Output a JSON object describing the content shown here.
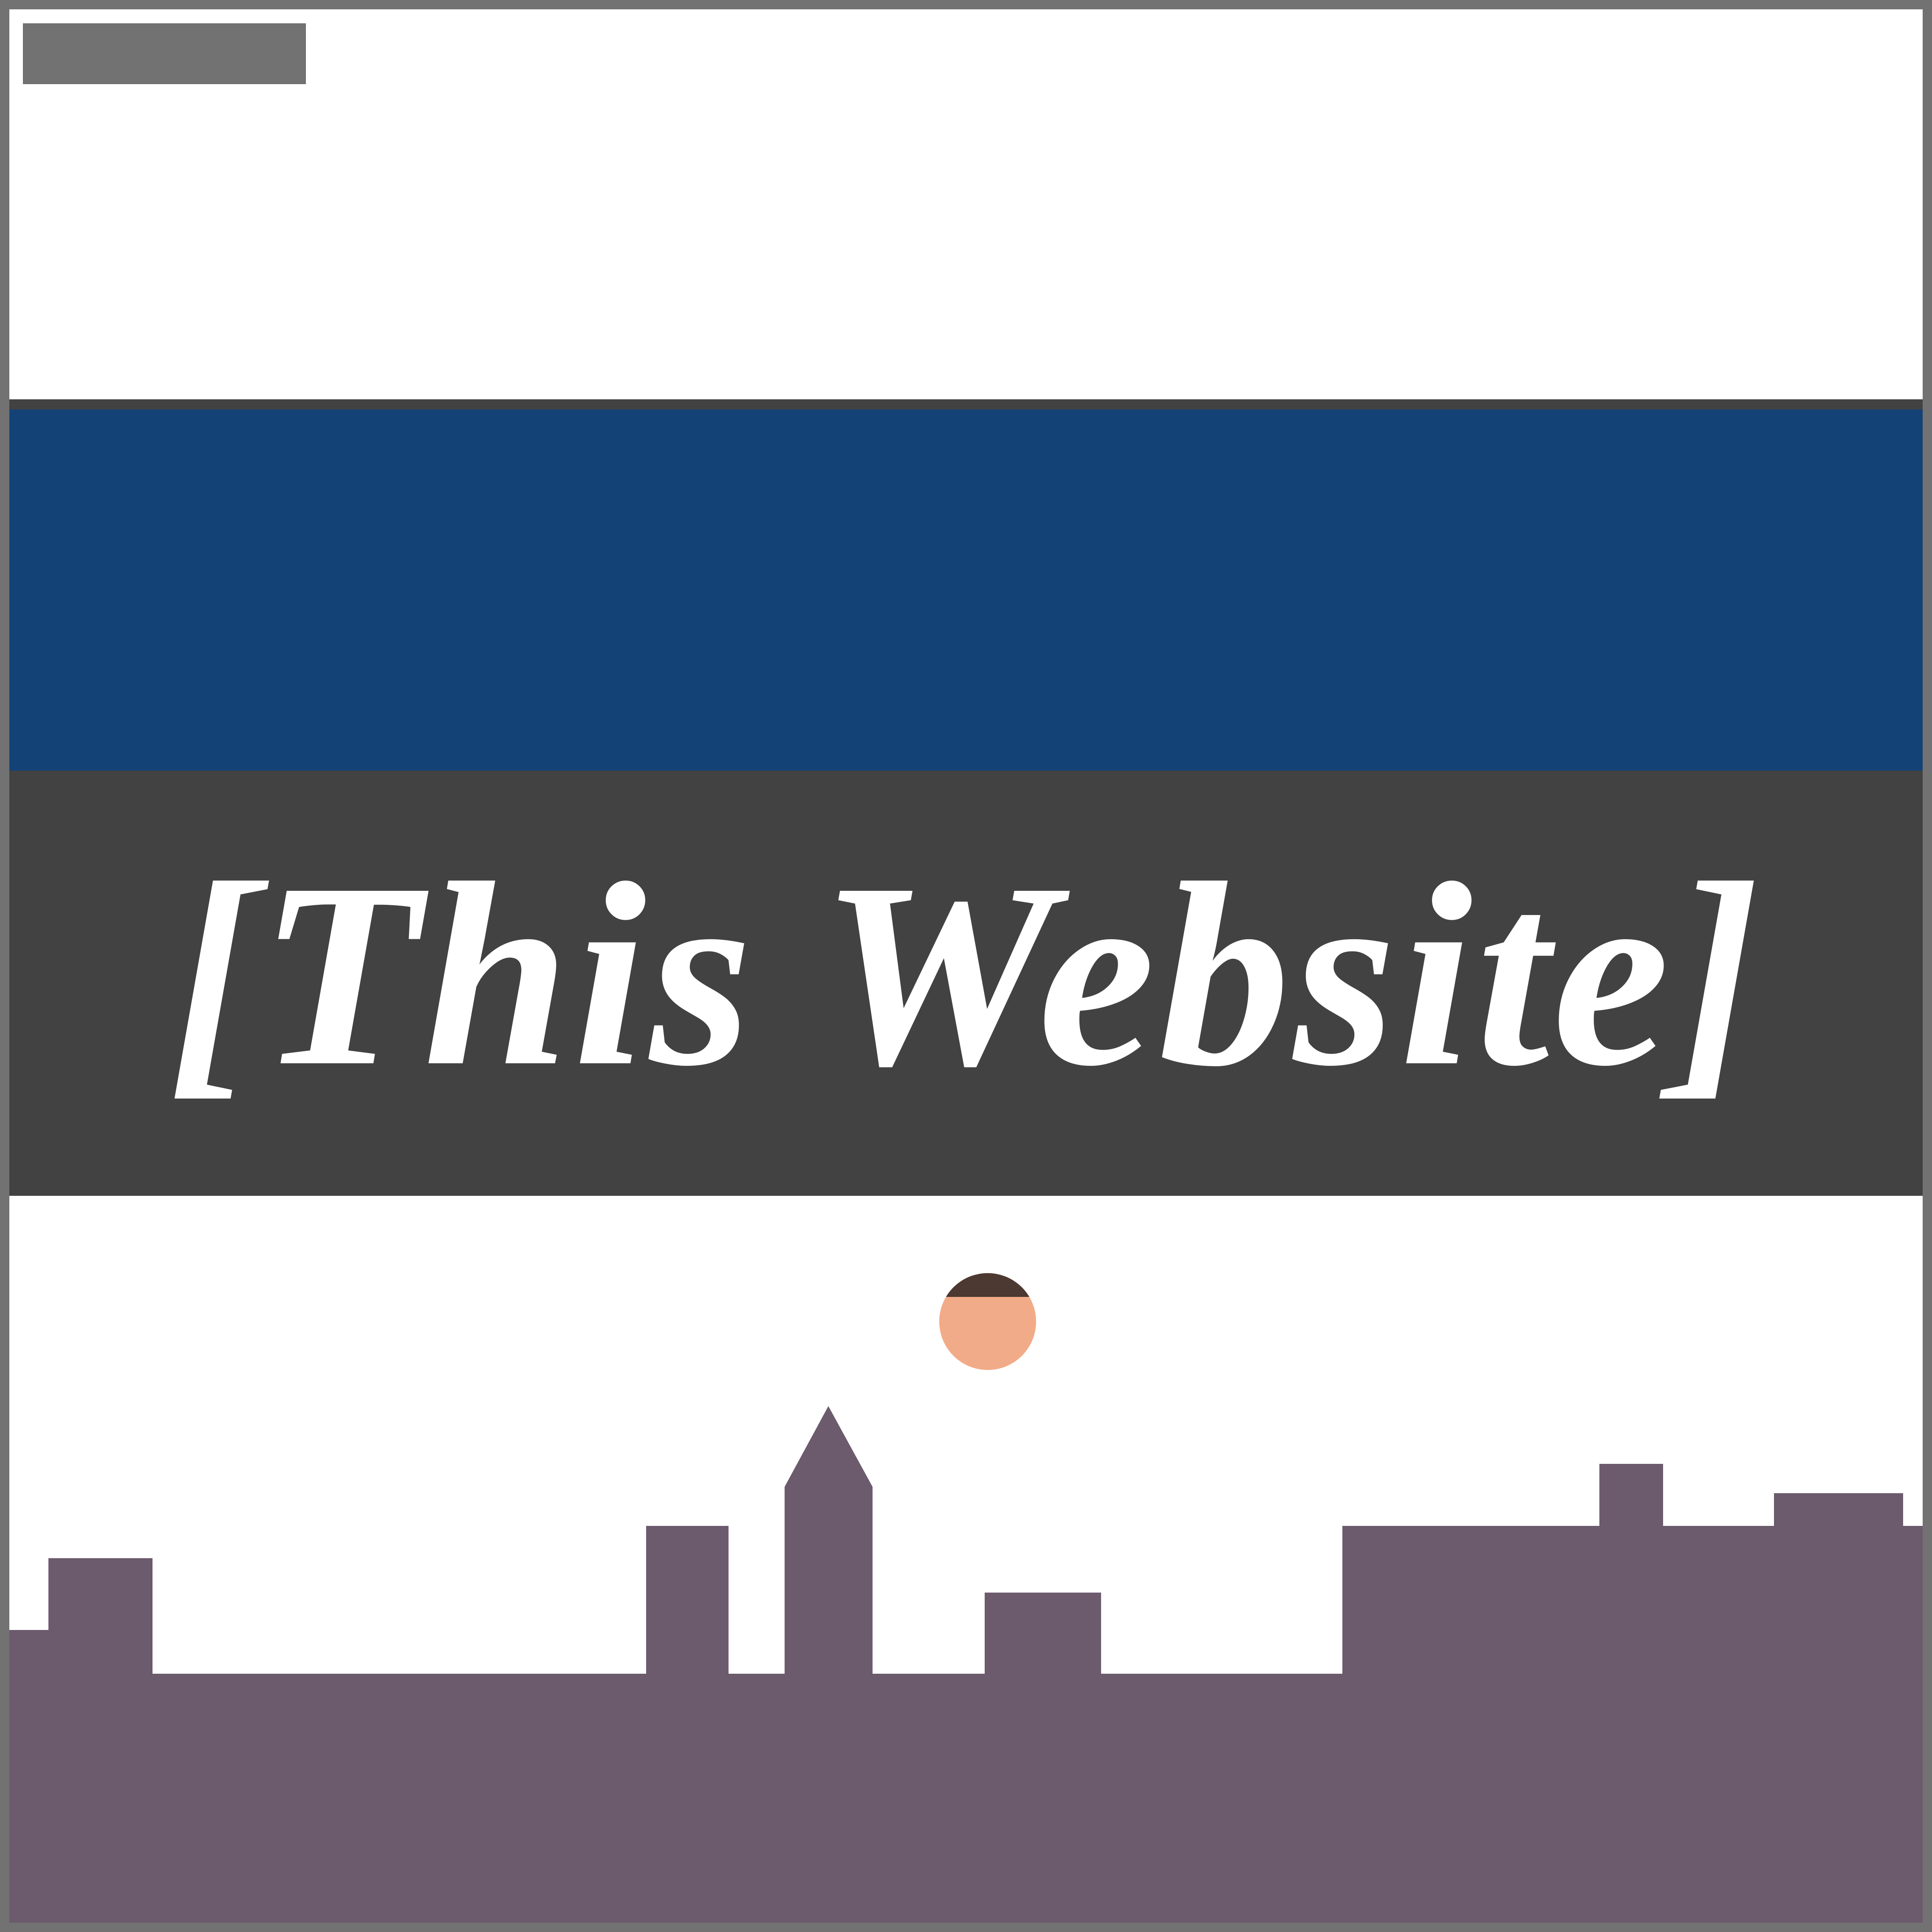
{
  "site": {
    "title": "[This Website]"
  },
  "colors": {
    "frame": "#727272",
    "background": "#ffffff",
    "top_tab": "#727272",
    "divider": "#424242",
    "blue_band": "#134277",
    "title_band": "#424242",
    "title_text": "#ffffff",
    "avatar_skin": "#f2ab88",
    "avatar_hair": "#4c3931",
    "skyline": "#6c5a6d"
  },
  "icons": {
    "avatar": "avatar-icon",
    "skyline": "city-skyline-icon"
  }
}
